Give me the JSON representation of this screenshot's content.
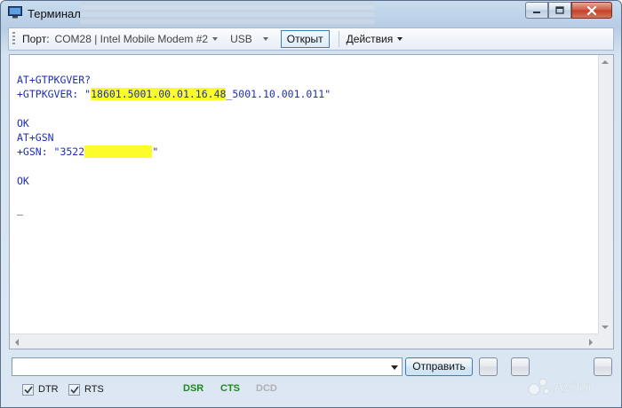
{
  "window": {
    "title": "Терминал",
    "controls": {
      "minimize_icon": "minimize-icon",
      "maximize_icon": "maximize-icon",
      "close_icon": "close-icon"
    }
  },
  "toolbar": {
    "port_label": "Порт:",
    "port_value": "COM28 | Intel Mobile Modem #2",
    "interface_value": "USB",
    "open_button": "Открыт",
    "actions_menu": "Действия"
  },
  "terminal": {
    "lines": [
      {
        "text": "AT+GTPKGVER?"
      },
      {
        "prefix": "+GTPKGVER: \"",
        "highlight": "18601.5001.00.01.16.48",
        "suffix": "_5001.10.001.011\""
      },
      {
        "text": ""
      },
      {
        "text": "OK"
      },
      {
        "text": "AT+GSN"
      },
      {
        "prefix": "+GSN: \"3522",
        "redacted": "XXXXXXXXXXX",
        "suffix": "\""
      },
      {
        "text": ""
      },
      {
        "text": "OK"
      },
      {
        "text": ""
      },
      {
        "cursor": "_"
      }
    ],
    "highlight_color": "#fcfc2a",
    "text_color": "#1f2fb8"
  },
  "command": {
    "value": "",
    "send_button": "Отправить"
  },
  "status": {
    "dtr_label": "DTR",
    "dtr_checked": true,
    "rts_label": "RTS",
    "rts_checked": true,
    "dsr": {
      "label": "DSR",
      "color": "#1a8a1a",
      "active": true
    },
    "cts": {
      "label": "CTS",
      "color": "#1a8a1a",
      "active": true
    },
    "dcd": {
      "label": "DCD",
      "color": "#b0b0b0",
      "active": false
    }
  },
  "watermark": {
    "text": "Avito"
  }
}
